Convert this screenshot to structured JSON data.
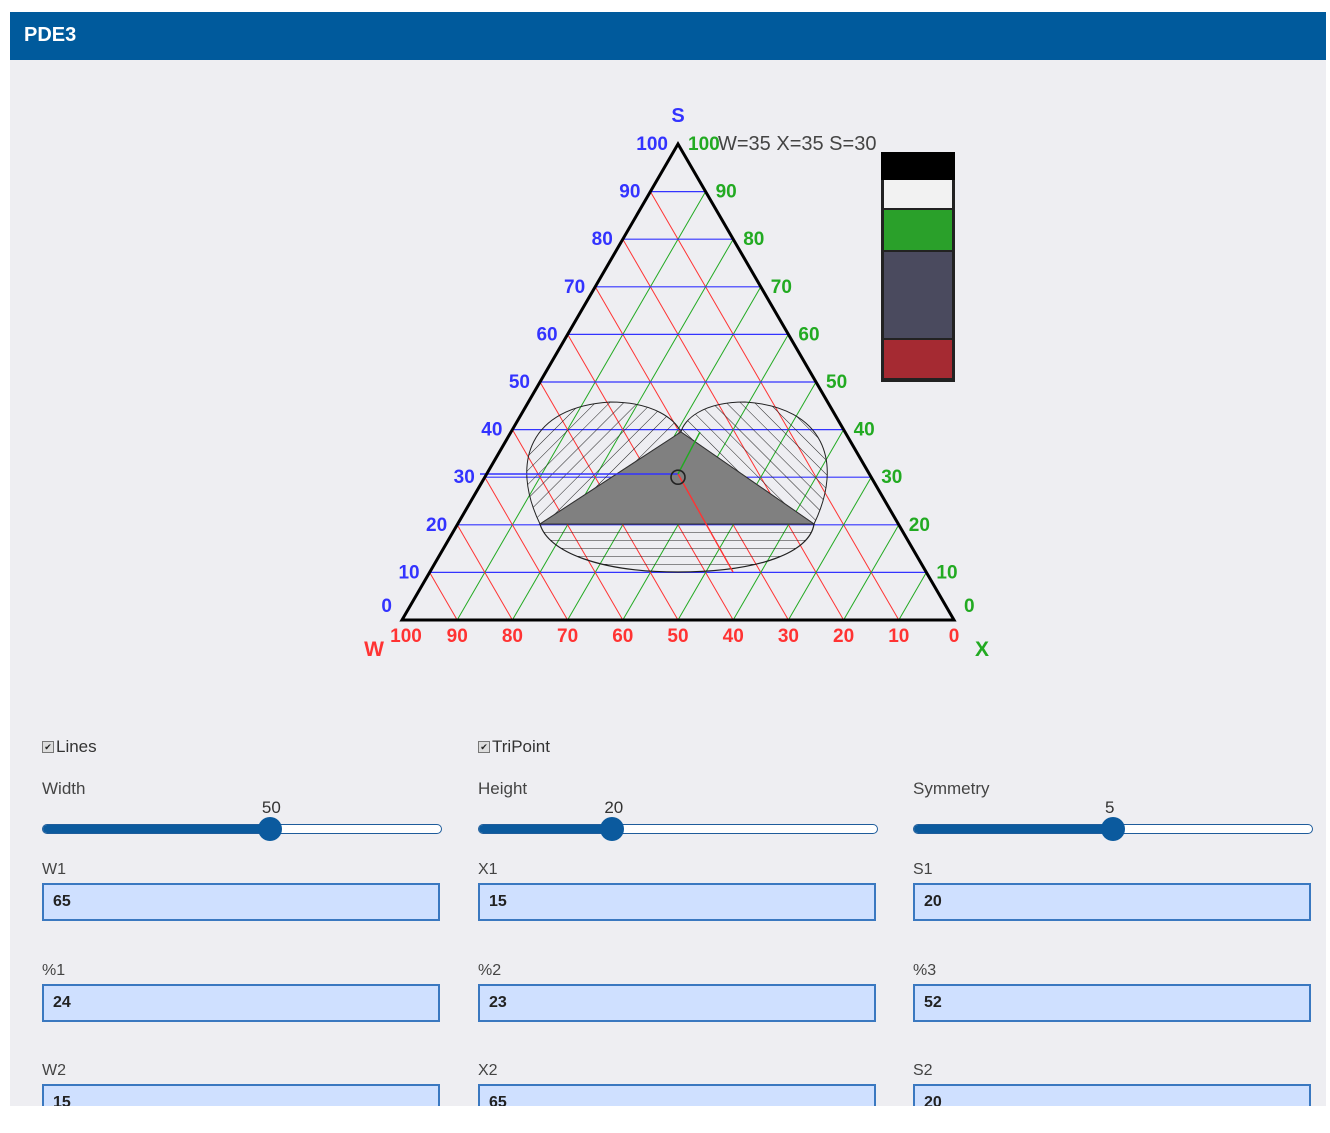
{
  "window": {
    "title": "PDE3"
  },
  "diagram": {
    "apex_labels": {
      "top": "S",
      "left": "W",
      "right": "X"
    },
    "readout": "W=35 X=35 S=30",
    "left_ticks": [
      "0",
      "10",
      "20",
      "30",
      "40",
      "50",
      "60",
      "70",
      "80",
      "90",
      "100"
    ],
    "right_ticks": [
      "0",
      "10",
      "20",
      "30",
      "40",
      "50",
      "60",
      "70",
      "80",
      "90",
      "100"
    ],
    "bottom_ticks": [
      "100",
      "90",
      "80",
      "70",
      "60",
      "50",
      "40",
      "30",
      "20",
      "10",
      "0"
    ],
    "colors": {
      "s_lines": "#3333ff",
      "w_lines": "#ff3333",
      "x_lines": "#22aa22",
      "region": "#808080"
    },
    "point": {
      "W": 35,
      "X": 35,
      "S": 30
    },
    "legend_colors": [
      "#000000",
      "#f2f2f2",
      "#2aa02a",
      "#4a4a5e",
      "#a52a32"
    ]
  },
  "controls": {
    "lines": {
      "label": "Lines",
      "checked": true
    },
    "tripoint": {
      "label": "TriPoint",
      "checked": true
    },
    "width": {
      "label": "Width",
      "value": "50",
      "fraction": 0.57
    },
    "height": {
      "label": "Height",
      "value": "20",
      "fraction": 0.335
    },
    "symmetry": {
      "label": "Symmetry",
      "value": "5",
      "fraction": 0.5
    }
  },
  "fields": {
    "w1": {
      "label": "W1",
      "value": "65"
    },
    "x1": {
      "label": "X1",
      "value": "15"
    },
    "s1": {
      "label": "S1",
      "value": "20"
    },
    "p1": {
      "label": "%1",
      "value": "24"
    },
    "p2": {
      "label": "%2",
      "value": "23"
    },
    "p3": {
      "label": "%3",
      "value": "52"
    },
    "w2": {
      "label": "W2",
      "value": "15"
    },
    "x2": {
      "label": "X2",
      "value": "65"
    },
    "s2": {
      "label": "S2",
      "value": "20"
    }
  }
}
